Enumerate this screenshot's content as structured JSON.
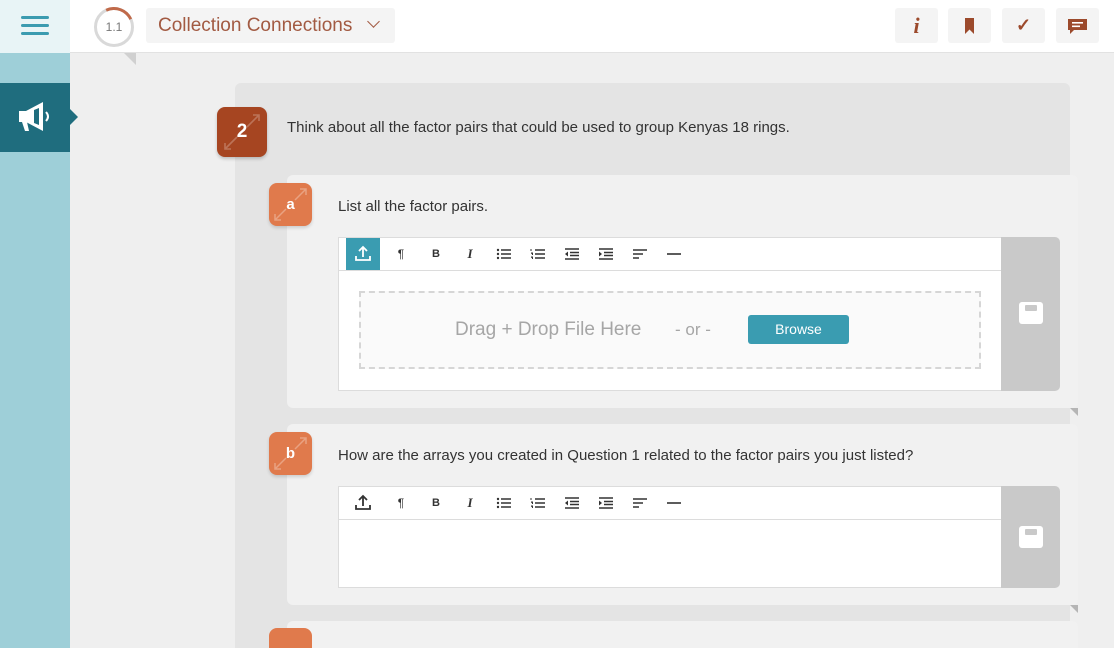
{
  "header": {
    "lesson_number": "1.1",
    "lesson_title": "Collection Connections",
    "tools": {
      "info": "i",
      "bookmark": "bookmark-icon",
      "check": "✓",
      "comment": "comment-icon"
    }
  },
  "sidebar": {
    "active_item_icon": "megaphone-icon"
  },
  "question": {
    "number": "2",
    "text": "Think about all the factor pairs that could be used to group Kenyas 18 rings."
  },
  "parts": [
    {
      "label": "a",
      "text": "List all the factor pairs.",
      "dropzone": {
        "drag_text": "Drag + Drop File Here",
        "or_text": "- or -",
        "browse_label": "Browse"
      }
    },
    {
      "label": "b",
      "text": "How are the arrays you created in Question 1 related to the factor pairs you just listed?"
    }
  ],
  "editor_toolbar": {
    "upload": "upload-icon",
    "paragraph": "¶",
    "bold": "B",
    "italic": "I",
    "bullet_list": "bullet-list-icon",
    "numbered_list": "numbered-list-icon",
    "outdent": "outdent-icon",
    "indent": "indent-icon",
    "align_left": "align-left-icon",
    "horizontal_rule": "horizontal-rule-icon"
  },
  "colors": {
    "teal": "#3a9cb1",
    "sidebar": "#9ecfd8",
    "sidebar_active": "#1f6d7e",
    "question_badge": "#a64521",
    "part_badge": "#e07a4c",
    "title_text": "#a25a42"
  }
}
